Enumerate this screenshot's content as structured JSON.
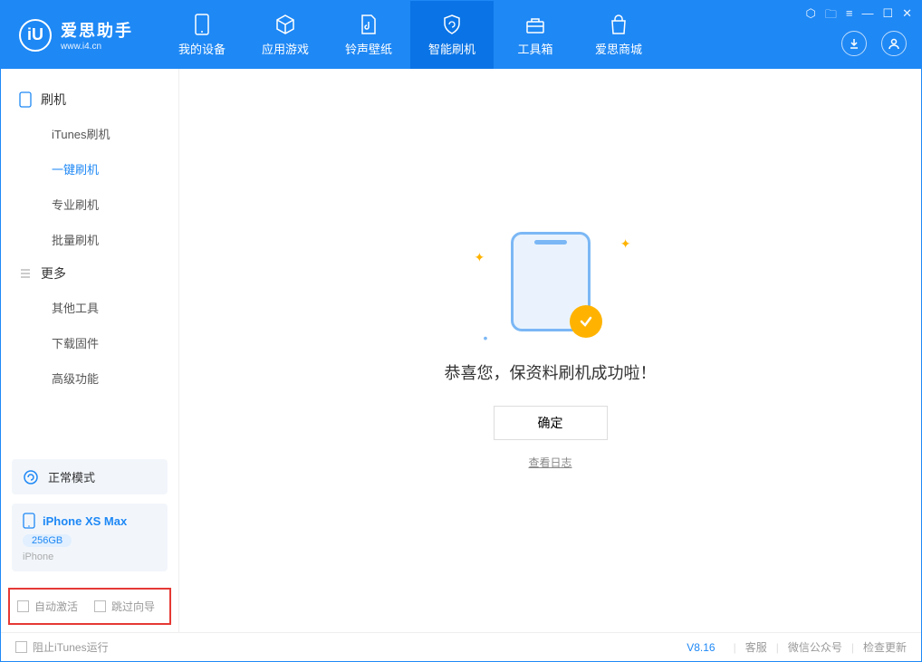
{
  "logo": {
    "title": "爱思助手",
    "subtitle": "www.i4.cn",
    "mark": "iU"
  },
  "nav": [
    {
      "label": "我的设备"
    },
    {
      "label": "应用游戏"
    },
    {
      "label": "铃声壁纸"
    },
    {
      "label": "智能刷机"
    },
    {
      "label": "工具箱"
    },
    {
      "label": "爱思商城"
    }
  ],
  "sidebar": {
    "section1": {
      "title": "刷机",
      "items": [
        "iTunes刷机",
        "一键刷机",
        "专业刷机",
        "批量刷机"
      ]
    },
    "section2": {
      "title": "更多",
      "items": [
        "其他工具",
        "下载固件",
        "高级功能"
      ]
    }
  },
  "mode": {
    "label": "正常模式"
  },
  "device": {
    "name": "iPhone XS Max",
    "capacity": "256GB",
    "type": "iPhone"
  },
  "checkboxes": {
    "auto_activate": "自动激活",
    "skip_guide": "跳过向导"
  },
  "main": {
    "success_text": "恭喜您，保资料刷机成功啦！",
    "ok_button": "确定",
    "view_log": "查看日志"
  },
  "footer": {
    "block_itunes": "阻止iTunes运行",
    "version": "V8.16",
    "links": [
      "客服",
      "微信公众号",
      "检查更新"
    ]
  }
}
